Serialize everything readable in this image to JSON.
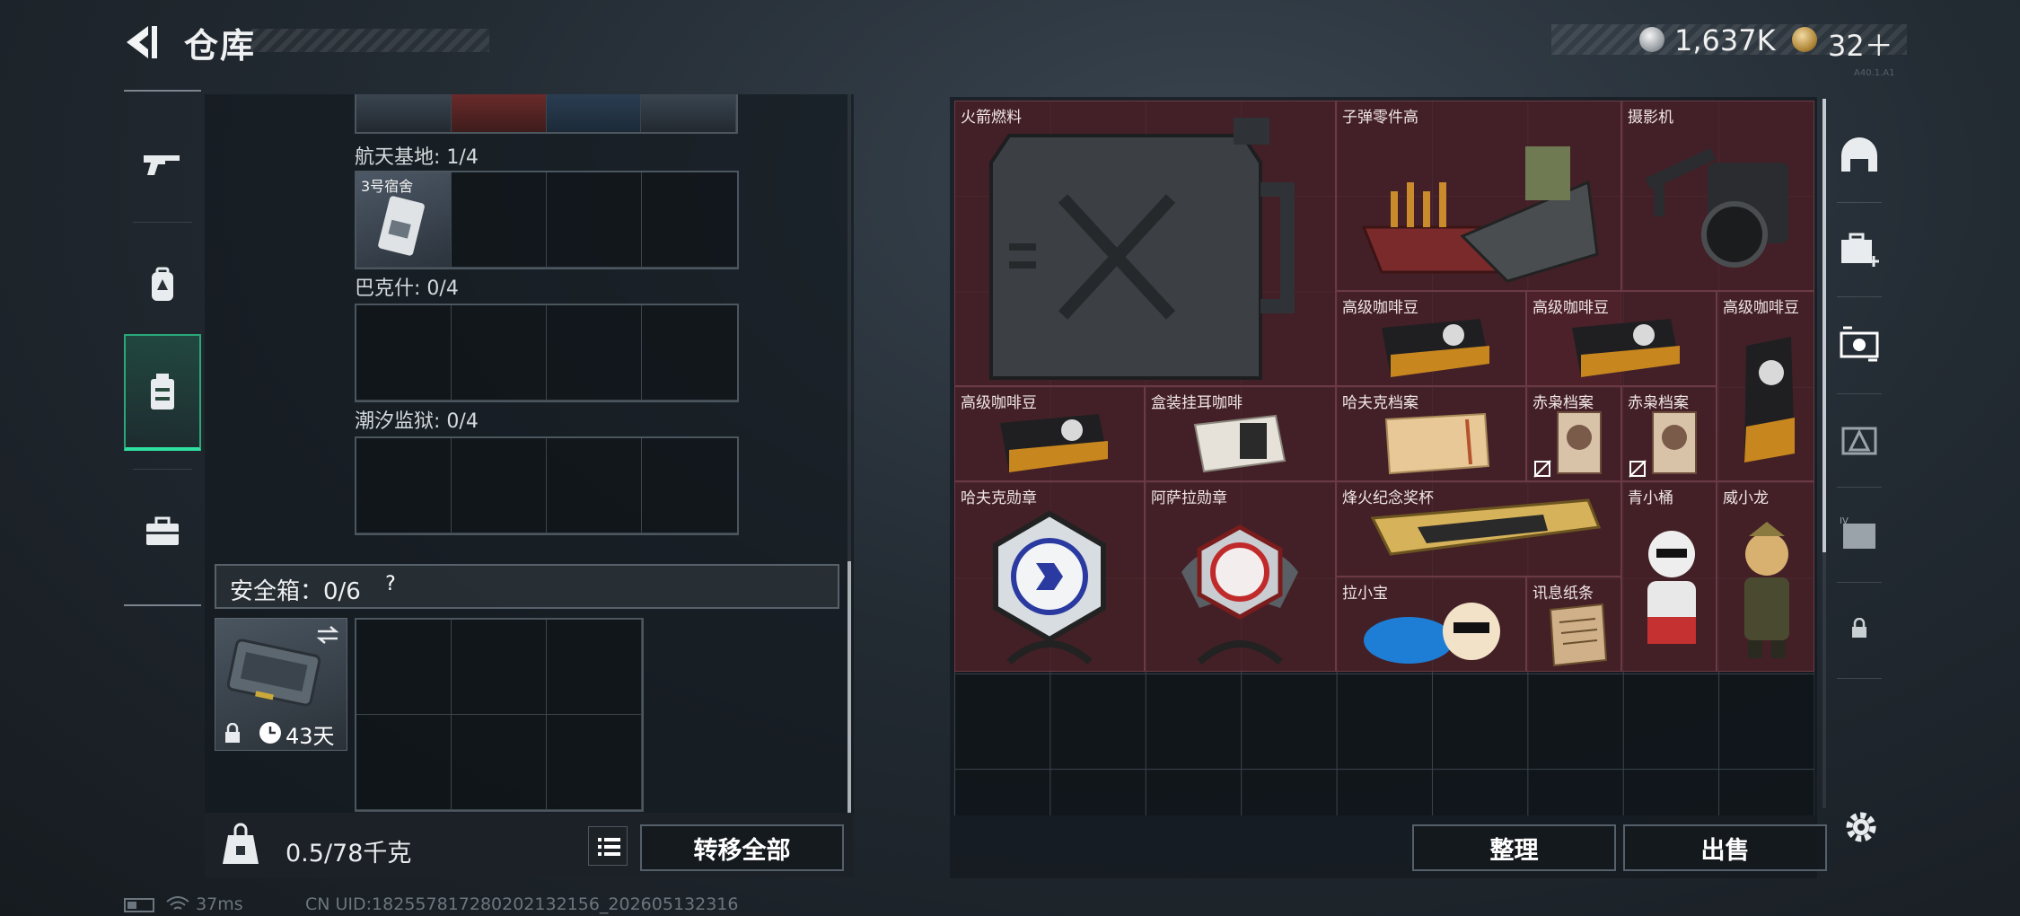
{
  "header": {
    "title": "仓库",
    "coins": "1,637K",
    "tokens": "32＋",
    "version": "A40.1.A1"
  },
  "left_nav": {
    "items": [
      {
        "icon": "rifle-icon"
      },
      {
        "icon": "backpack-icon"
      },
      {
        "icon": "vest-icon",
        "active": true
      },
      {
        "icon": "briefcase-icon"
      }
    ]
  },
  "inventory": {
    "sections": [
      {
        "label": "航天基地: 1/4",
        "slots": [
          {
            "name": "3号宿舍",
            "kind": "keycard"
          }
        ]
      },
      {
        "label": "巴克什: 0/4",
        "slots": []
      },
      {
        "label": "潮汐监狱: 0/4",
        "slots": []
      }
    ],
    "safe": {
      "label": "安全箱：0/6",
      "help": "?",
      "days": "43天"
    },
    "weight": "0.5/78千克",
    "transfer_all": "转移全部"
  },
  "stash": {
    "items": [
      {
        "name": "火箭燃料"
      },
      {
        "name": "子弹零件高"
      },
      {
        "name": "摄影机"
      },
      {
        "name": "高级咖啡豆"
      },
      {
        "name": "高级咖啡豆"
      },
      {
        "name": "高级咖啡豆"
      },
      {
        "name": "高级咖啡豆"
      },
      {
        "name": "盒装挂耳咖啡"
      },
      {
        "name": "哈夫克档案"
      },
      {
        "name": "赤枭档案"
      },
      {
        "name": "赤枭档案"
      },
      {
        "name": "哈夫克勋章"
      },
      {
        "name": "阿萨拉勋章"
      },
      {
        "name": "烽火纪念奖杯"
      },
      {
        "name": "青小桶"
      },
      {
        "name": "威小龙"
      },
      {
        "name": "拉小宝"
      },
      {
        "name": "讯息纸条"
      }
    ],
    "sort_label": "整理",
    "sell_label": "出售"
  },
  "right_nav": {
    "items": [
      {
        "icon": "dome-icon"
      },
      {
        "icon": "medkit-icon"
      },
      {
        "icon": "scanner-icon",
        "active": true
      },
      {
        "icon": "triangle-icon"
      },
      {
        "icon": "folder-iv-icon"
      },
      {
        "icon": "lock-icon"
      }
    ]
  },
  "status": {
    "ping": "37ms",
    "uid": "CN UID:182557817280202132156_202605132316"
  }
}
